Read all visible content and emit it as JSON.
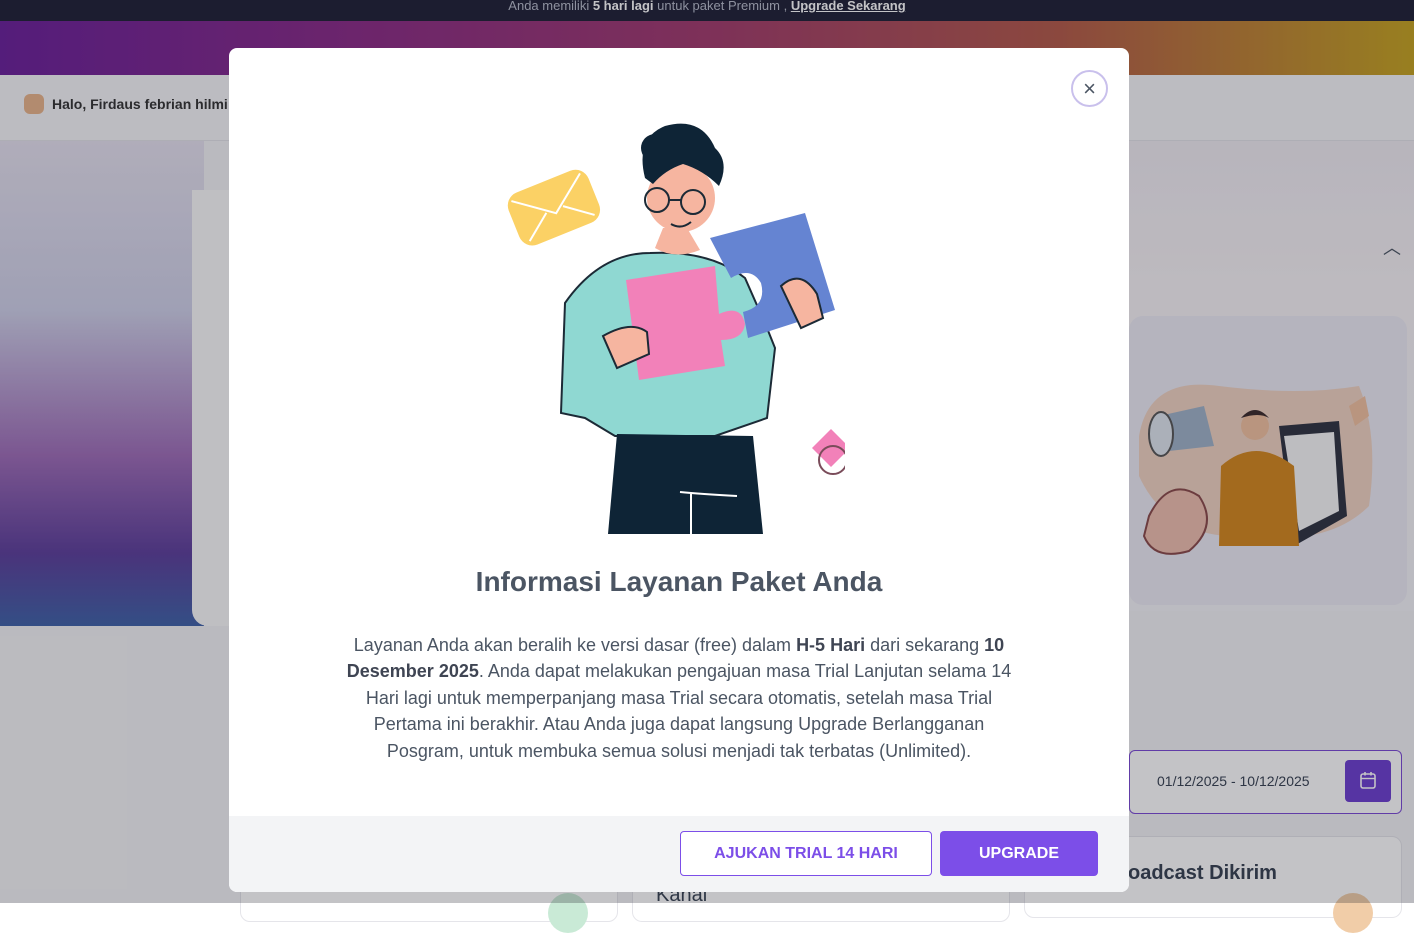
{
  "banner": {
    "prefix": "Anda memiliki ",
    "days": "5 hari lagi",
    "middle": " untuk paket Premium , ",
    "link": "Upgrade Sekarang"
  },
  "header": {
    "greeting": "Halo, Firdaus febrian hilmi"
  },
  "filter": {
    "date_range": "01/12/2025 - 10/12/2025"
  },
  "stats": {
    "broadcast_title": "oadcast Dikirim",
    "kanal_title": "Kanal"
  },
  "modal": {
    "title": "Informasi Layanan Paket Anda",
    "body_part1": "Layanan Anda akan beralih ke versi dasar (free) dalam ",
    "body_bold1": "H-5 Hari",
    "body_part2": " dari sekarang ",
    "body_bold2": "10 Desember 2025",
    "body_part3": ". Anda dapat melakukan pengajuan masa Trial Lanjutan selama 14 Hari lagi untuk memperpanjang masa Trial secara otomatis, setelah masa Trial Pertama ini berakhir. Atau Anda juga dapat langsung Upgrade Berlangganan Posgram, untuk membuka semua solusi menjadi tak terbatas (Unlimited).",
    "trial_button": "AJUKAN TRIAL 14 HARI",
    "upgrade_button": "UPGRADE",
    "close_symbol": "×"
  },
  "colors": {
    "primary": "#7c4ee8",
    "topbar": "#1e2035"
  },
  "icons": [
    "hand-wave-icon",
    "chevron-up-icon",
    "calendar-icon",
    "close-icon"
  ]
}
